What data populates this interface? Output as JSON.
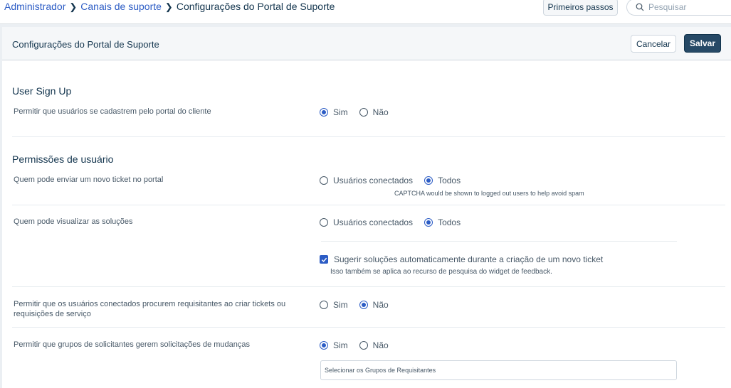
{
  "breadcrumb": {
    "items": [
      "Administrador",
      "Canais de suporte",
      "Configurações do Portal de Suporte"
    ]
  },
  "topbar": {
    "first_steps_label": "Primeiros passos",
    "search_placeholder": "Pesquisar"
  },
  "header": {
    "title": "Configurações do Portal de Suporte",
    "cancel_label": "Cancelar",
    "save_label": "Salvar"
  },
  "sections": {
    "signup": {
      "title": "User Sign Up",
      "allow_signup": {
        "label": "Permitir que usuários se cadastrem pelo portal do cliente",
        "options": [
          "Sim",
          "Não"
        ],
        "selected": "Sim"
      }
    },
    "permissions": {
      "title": "Permissões de usuário",
      "submit_ticket": {
        "label": "Quem pode enviar um novo ticket no portal",
        "options": [
          "Usuários conectados",
          "Todos"
        ],
        "selected": "Todos",
        "hint": "CAPTCHA would be shown to logged out users to help avoid spam"
      },
      "view_solutions": {
        "label": "Quem pode visualizar as soluções",
        "options": [
          "Usuários conectados",
          "Todos"
        ],
        "selected": "Todos",
        "suggest_checkbox_label": "Sugerir soluções automaticamente durante a criação de um novo ticket",
        "suggest_checked": true,
        "suggest_hint": "Isso também se aplica ao recurso de pesquisa do widget de feedback."
      },
      "search_requesters": {
        "label": "Permitir que os usuários conectados procurem requisitantes ao criar tickets ou requisições de serviço",
        "options": [
          "Sim",
          "Não"
        ],
        "selected": "Não"
      },
      "requester_groups": {
        "label": "Permitir que grupos de solicitantes gerem solicitações de mudanças",
        "options": [
          "Sim",
          "Não"
        ],
        "selected": "Sim",
        "select_placeholder": "Selecionar os Grupos de Requisitantes"
      }
    }
  },
  "colors": {
    "accent": "#2c5cc5",
    "primary_button": "#264966",
    "text": "#12344d"
  }
}
